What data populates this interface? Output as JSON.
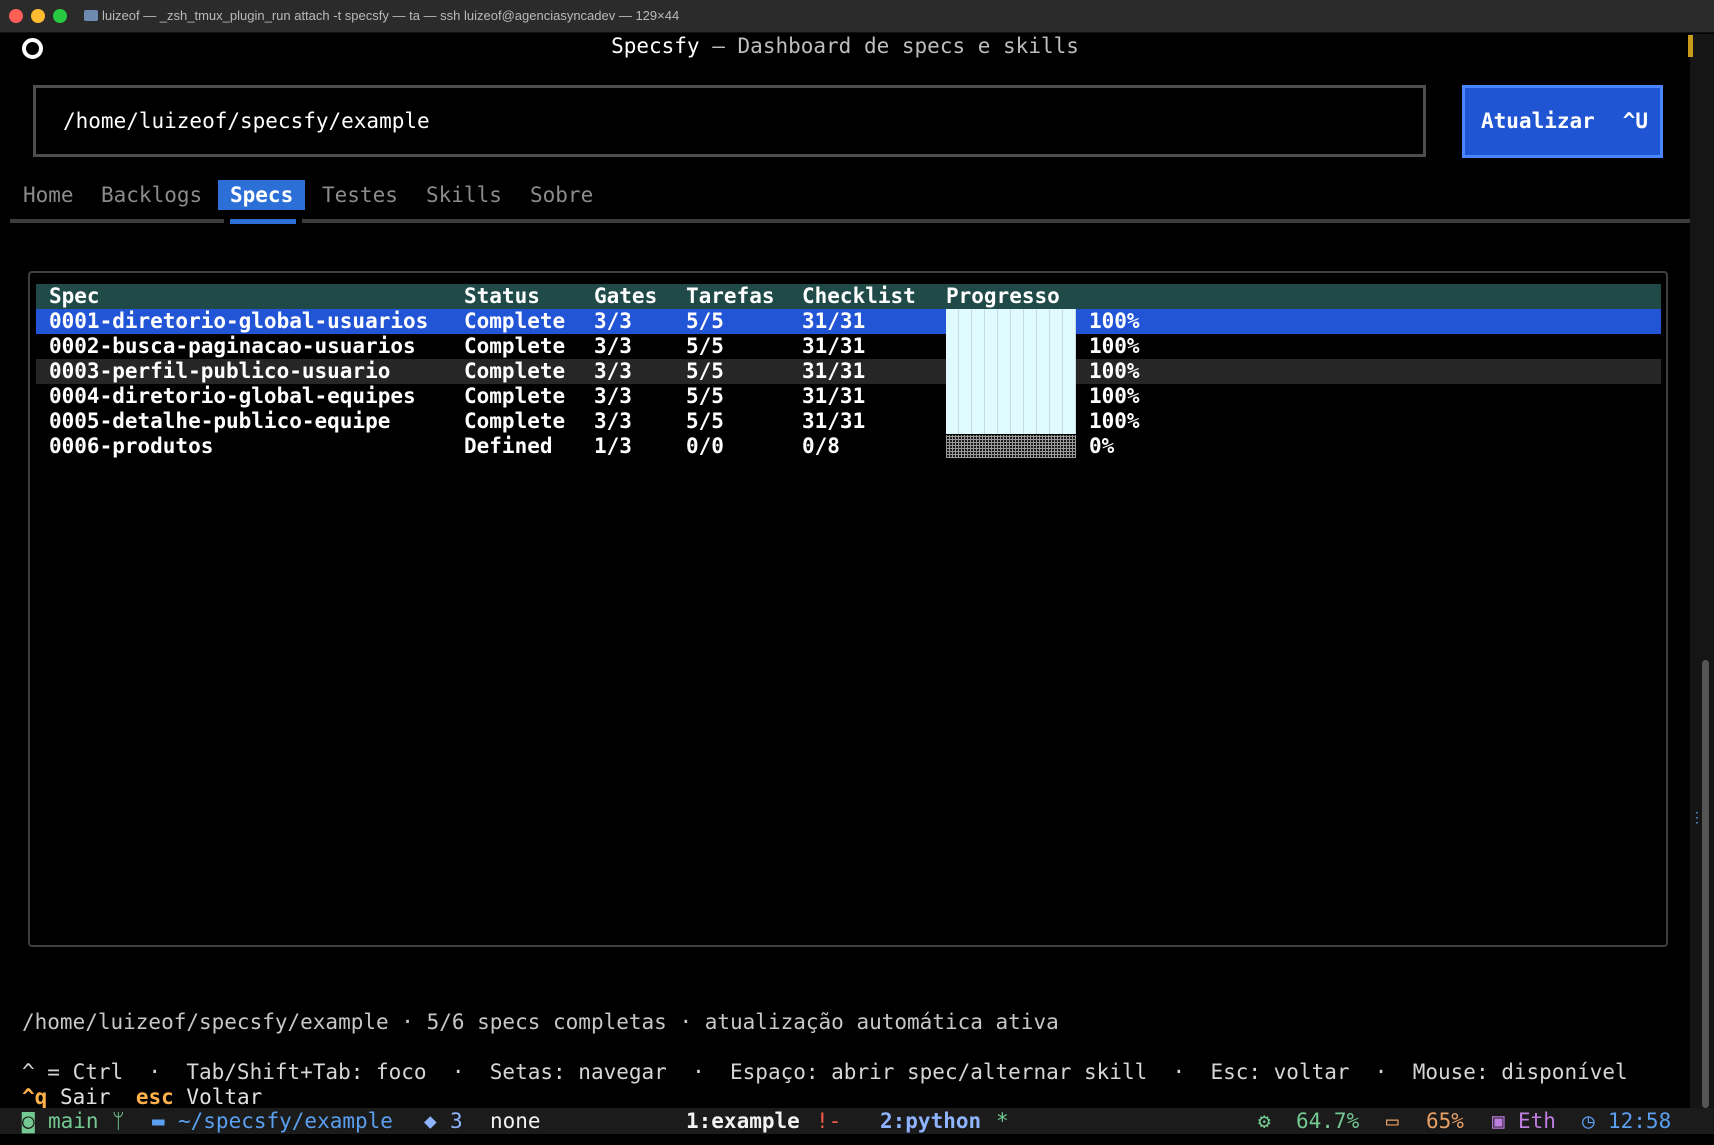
{
  "window": {
    "title": "luizeof — _zsh_tmux_plugin_run attach -t specsfy — ta — ssh luizeof@agenciasyncadev — 129×44"
  },
  "header": {
    "app_name": "Specsfy",
    "separator": " — ",
    "subtitle": "Dashboard de specs e skills"
  },
  "path_input": {
    "value": "/home/luizeof/specsfy/example"
  },
  "refresh_button": {
    "label": "Atualizar",
    "shortcut": "^U"
  },
  "tabs": [
    {
      "label": "Home"
    },
    {
      "label": "Backlogs"
    },
    {
      "label": "Specs",
      "active": true
    },
    {
      "label": "Testes"
    },
    {
      "label": "Skills"
    },
    {
      "label": "Sobre"
    }
  ],
  "table": {
    "headers": {
      "spec": "Spec",
      "status": "Status",
      "gates": "Gates",
      "tasks": "Tarefas",
      "checklist": "Checklist",
      "progress": "Progresso"
    },
    "rows": [
      {
        "spec": "0001-diretorio-global-usuarios",
        "status": "Complete",
        "gates": "3/3",
        "tasks": "5/5",
        "checklist": "31/31",
        "progress": 1.0,
        "pct": "100%"
      },
      {
        "spec": "0002-busca-paginacao-usuarios",
        "status": "Complete",
        "gates": "3/3",
        "tasks": "5/5",
        "checklist": "31/31",
        "progress": 1.0,
        "pct": "100%"
      },
      {
        "spec": "0003-perfil-publico-usuario",
        "status": "Complete",
        "gates": "3/3",
        "tasks": "5/5",
        "checklist": "31/31",
        "progress": 1.0,
        "pct": "100%"
      },
      {
        "spec": "0004-diretorio-global-equipes",
        "status": "Complete",
        "gates": "3/3",
        "tasks": "5/5",
        "checklist": "31/31",
        "progress": 1.0,
        "pct": "100%"
      },
      {
        "spec": "0005-detalhe-publico-equipe",
        "status": "Complete",
        "gates": "3/3",
        "tasks": "5/5",
        "checklist": "31/31",
        "progress": 1.0,
        "pct": "100%"
      },
      {
        "spec": "0006-produtos",
        "status": "Defined",
        "gates": "1/3",
        "tasks": "0/0",
        "checklist": "0/8",
        "progress": 0.0,
        "pct": "0%"
      }
    ]
  },
  "footer": {
    "status": "/home/luizeof/specsfy/example · 5/6 specs completas · atualização automática ativa",
    "help": "^ = Ctrl  ·  Tab/Shift+Tab: foco  ·  Setas: navegar  ·  Espaço: abrir spec/alternar skill  ·  Esc: voltar  ·  Mouse: disponível",
    "quit_key": "^q",
    "quit_label": "Sair",
    "back_key": "esc",
    "back_label": "Voltar"
  },
  "tmux": {
    "branch": "main",
    "dir": "~/specsfy/example",
    "docker_count": "3",
    "docker_ctx": "none",
    "window1": "1:example",
    "window1_flag": "!-",
    "window2": "2:python",
    "window2_flag": "*",
    "cpu": "64.7%",
    "mem": "65%",
    "net": "Eth",
    "time": "12:58"
  },
  "colors": {
    "accent": "#2c6fd7",
    "selected_row": "#2255d6",
    "header_row": "#1f4a48",
    "progress_fill": "#dffbff",
    "key_accent": "#ffb14a"
  }
}
